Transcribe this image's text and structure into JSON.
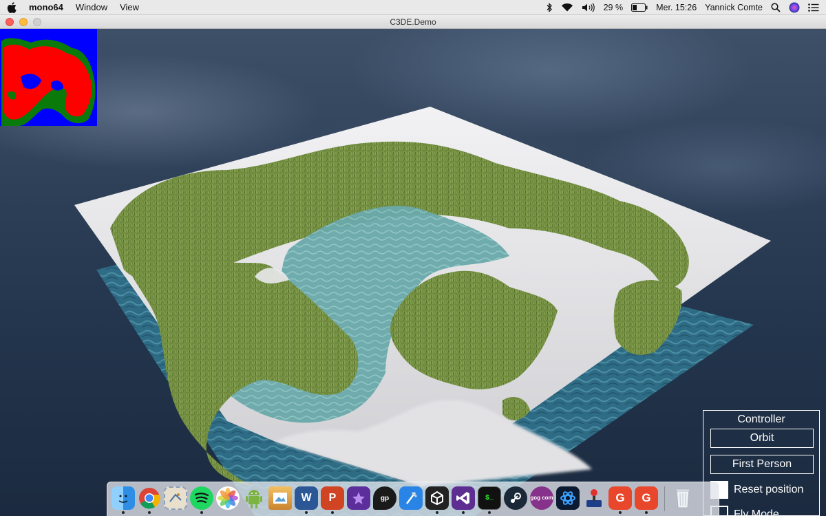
{
  "menubar": {
    "app_name": "mono64",
    "menus": [
      "Window",
      "View"
    ],
    "battery_percent": "29 %",
    "clock": "Mer. 15:26",
    "user": "Yannick Comte"
  },
  "window": {
    "title": "C3DE.Demo"
  },
  "controller": {
    "title": "Controller",
    "orbit_label": "Orbit",
    "first_person_label": "First Person",
    "reset_position_label": "Reset position",
    "reset_position_checked": true,
    "fly_mode_label": "Fly Mode",
    "fly_mode_checked": false
  },
  "dock": {
    "items": [
      {
        "name": "finder",
        "running": true
      },
      {
        "name": "chrome",
        "running": true
      },
      {
        "name": "mail-stamp",
        "running": false
      },
      {
        "name": "spotify",
        "running": true
      },
      {
        "name": "photos",
        "running": false
      },
      {
        "name": "android-studio",
        "running": false
      },
      {
        "name": "preview",
        "running": false
      },
      {
        "name": "word",
        "running": true
      },
      {
        "name": "powerpoint",
        "running": true
      },
      {
        "name": "imovie",
        "running": false
      },
      {
        "name": "guitar-pro",
        "running": false
      },
      {
        "name": "xcode",
        "running": false
      },
      {
        "name": "unity",
        "running": true
      },
      {
        "name": "visual-studio",
        "running": true
      },
      {
        "name": "terminal",
        "running": true
      },
      {
        "name": "steam",
        "running": false
      },
      {
        "name": "gog-galaxy",
        "running": false
      },
      {
        "name": "battle-net",
        "running": false
      },
      {
        "name": "joystick",
        "running": false
      },
      {
        "name": "game-maker-1",
        "running": true
      },
      {
        "name": "game-maker-2",
        "running": true
      },
      {
        "name": "trash",
        "running": false
      }
    ],
    "gog_label": "gog com"
  },
  "colors": {
    "terrain_snow": "#e8e8ea",
    "terrain_grass": "#6f8a3d",
    "water": "#5f9fa4",
    "minimap_water": "#0000ff",
    "minimap_land": "#ff0000",
    "minimap_grass": "#0a7a0a"
  }
}
